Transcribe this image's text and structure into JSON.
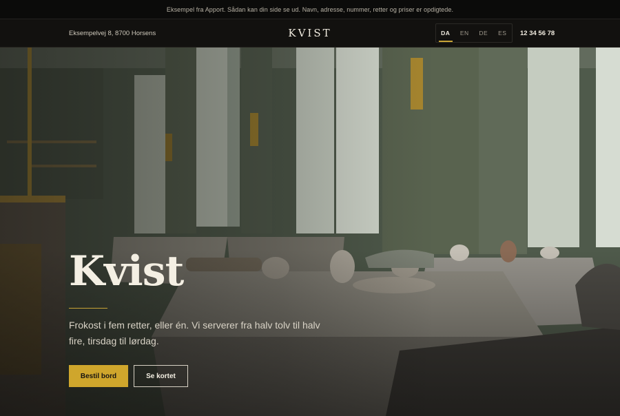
{
  "notice": "Eksempel fra Apport. Sådan kan din side se ud. Navn, adresse, nummer, retter og priser er opdigtede.",
  "header": {
    "address": "Eksempelvej 8, 8700 Horsens",
    "logo": "KVIST",
    "languages": [
      "DA",
      "EN",
      "DE",
      "ES"
    ],
    "active_language": "DA",
    "phone": "12 34 56 78"
  },
  "hero": {
    "title": "Kvist",
    "text": "Frokost i fem retter, eller én. Vi serverer fra halv tolv til halv fire, tirsdag til lørdag.",
    "primary_button": "Bestil bord",
    "secondary_button": "Se kortet"
  },
  "colors": {
    "accent": "#cfa62c",
    "header_bg": "#12110f",
    "wall": "#55604f"
  }
}
